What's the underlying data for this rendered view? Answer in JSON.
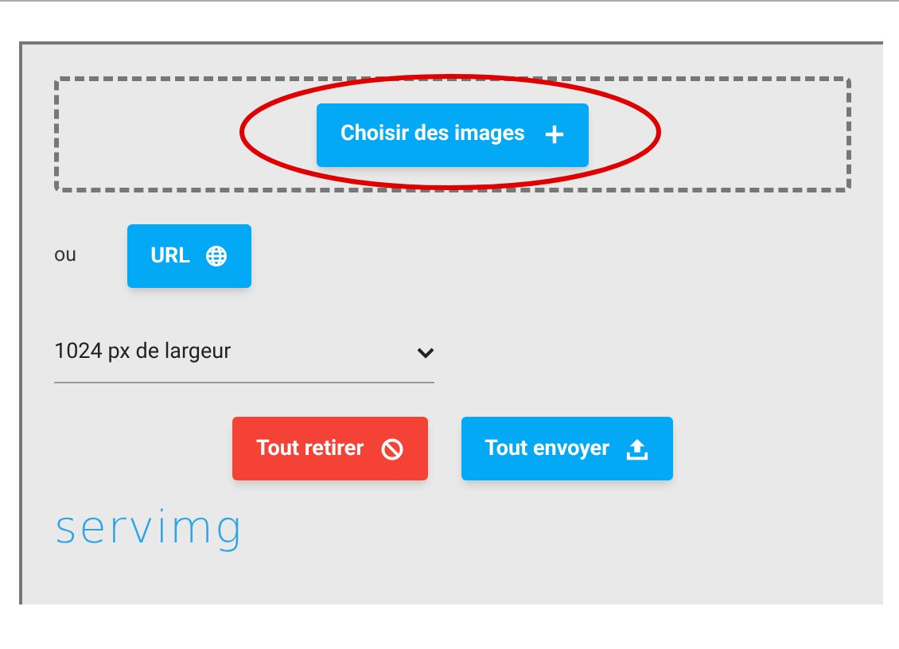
{
  "upload": {
    "button": "Choisir des images"
  },
  "or_label": "ou",
  "url_button": "URL",
  "size_select": {
    "value": "1024 px de largeur"
  },
  "actions": [
    {
      "label": "Tout retirer",
      "kind": "danger"
    },
    {
      "label": "Tout envoyer",
      "kind": "primary"
    }
  ],
  "logo": "servimg"
}
